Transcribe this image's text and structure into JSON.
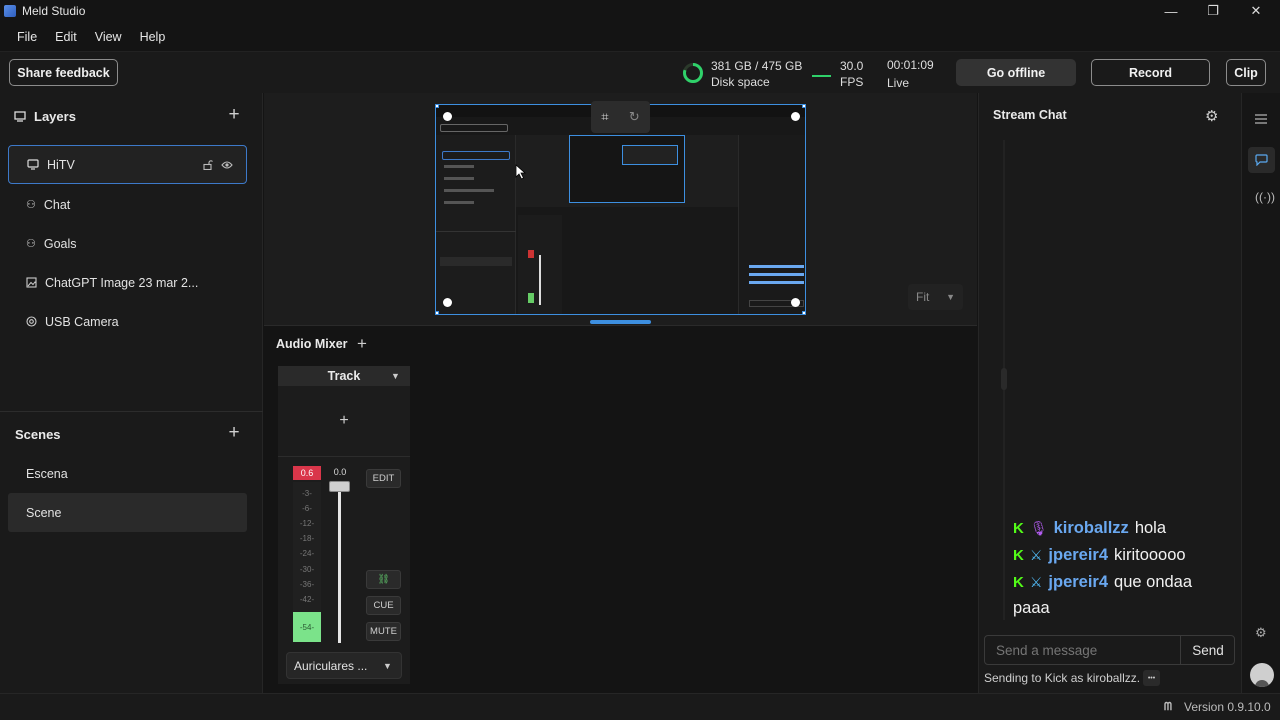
{
  "window": {
    "title": "Meld Studio",
    "minimize": "—",
    "maximize": "❐",
    "close": "✕"
  },
  "menu": [
    "File",
    "Edit",
    "View",
    "Help"
  ],
  "toolbar": {
    "share_feedback": "Share feedback",
    "disk_value": "381 GB / 475 GB",
    "disk_label": "Disk space",
    "fps_value": "30.0",
    "fps_label": "FPS",
    "time_value": "00:01:09",
    "time_label": "Live",
    "go_offline": "Go offline",
    "record": "Record",
    "clip": "Clip",
    "disk_usage_fraction": 0.8,
    "accent_green": "#53fc18"
  },
  "layers": {
    "title": "Layers",
    "items": [
      {
        "label": "HiTV",
        "icon": "monitor-icon",
        "active": true
      },
      {
        "label": "Chat",
        "icon": "widget-icon"
      },
      {
        "label": "Goals",
        "icon": "widget-icon"
      },
      {
        "label": "ChatGPT Image 23 mar 2...",
        "icon": "image-icon"
      },
      {
        "label": "USB Camera",
        "icon": "camera-icon"
      }
    ]
  },
  "scenes": {
    "title": "Scenes",
    "items": [
      {
        "label": "Escena"
      },
      {
        "label": "Scene",
        "active": true
      }
    ]
  },
  "canvas": {
    "fit_label": "Fit"
  },
  "audio_mixer": {
    "title": "Audio Mixer",
    "track_label": "Track",
    "peak_value": "0.6",
    "fader_value": "0.0",
    "ticks": [
      "-3-",
      "-6-",
      "-12-",
      "-18-",
      "-24-",
      "-30-",
      "-36-",
      "-42-",
      "-54-"
    ],
    "edit": "EDIT",
    "cue": "CUE",
    "mute": "MUTE",
    "device": "Auriculares ..."
  },
  "chat": {
    "title": "Stream Chat",
    "messages": [
      {
        "badge": "K",
        "role_icon": "microphone-icon",
        "user": "kiroballzz",
        "text": "hola"
      },
      {
        "badge": "K",
        "role_icon": "sword-icon",
        "user": "jpereir4",
        "text": "kiritooooo"
      },
      {
        "badge": "K",
        "role_icon": "sword-icon",
        "user": "jpereir4",
        "text": "que ondaa"
      }
    ],
    "continuation": "paaa",
    "input_placeholder": "Send a message",
    "send": "Send",
    "sending_as": "Sending to Kick as kiroballzz.",
    "more": "•••"
  },
  "status": {
    "version": "Version 0.9.10.0"
  }
}
